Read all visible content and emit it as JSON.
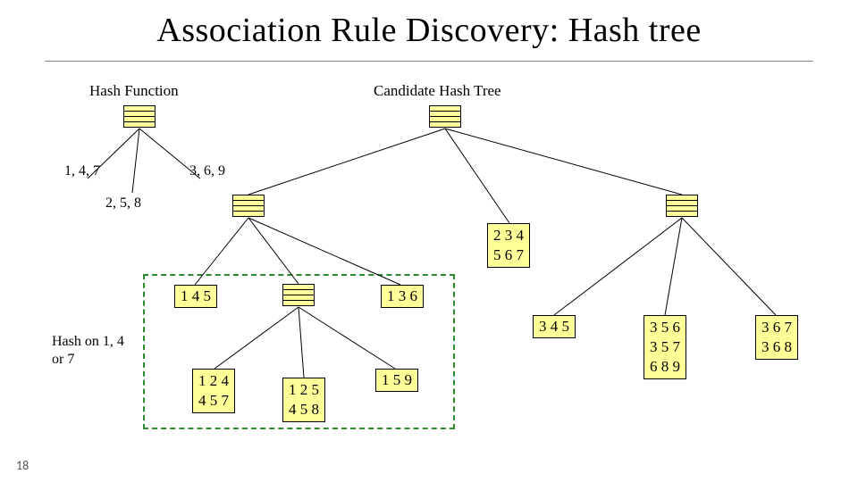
{
  "title": "Association Rule Discovery: Hash tree",
  "labels": {
    "hash_function": "Hash Function",
    "candidate_tree": "Candidate Hash Tree",
    "branch_left": "1, 4, 7",
    "branch_mid": "2, 5, 8",
    "branch_right": "3, 6, 9",
    "hash_on": "Hash on 1, 4\nor 7"
  },
  "leaves": {
    "L145": "1 4 5",
    "L234": "2 3 4",
    "L567": "5 6 7",
    "L136": "1 3 6",
    "L345": "3 4 5",
    "L356": "3 5 6",
    "L357": "3 5 7",
    "L689": "6 8 9",
    "L367": "3 6 7",
    "L368": "3 6 8",
    "L124": "1 2 4",
    "L457": "4 5 7",
    "L125": "1 2 5",
    "L458": "4 5 8",
    "L159": "1 5 9"
  },
  "page_number": "18",
  "chart_data": {
    "type": "tree",
    "description": "Candidate hash tree for 3-itemsets. Hash function on each internal node: left child if key mod in {1,4,7}, middle if {2,5,8}, right if {3,6,9}. Dashed box highlights subtree reached by hashing on first item in {1,4,7}.",
    "hash_function": {
      "left": [
        1,
        4,
        7
      ],
      "middle": [
        2,
        5,
        8
      ],
      "right": [
        3,
        6,
        9
      ]
    },
    "root_children": {
      "left": {
        "children": {
          "left": [
            "1 4 5"
          ],
          "middle": {
            "children": {
              "left": [
                "1 2 4",
                "4 5 7"
              ],
              "middle": [
                "1 2 5",
                "4 5 8"
              ],
              "right": [
                "1 5 9"
              ]
            }
          },
          "right": [
            "1 3 6"
          ]
        }
      },
      "middle": [
        "2 3 4",
        "5 6 7"
      ],
      "right": {
        "children": {
          "left": [
            "3 4 5"
          ],
          "middle": [
            "3 5 6",
            "3 5 7",
            "6 8 9"
          ],
          "right": [
            "3 6 7",
            "3 6 8"
          ]
        }
      }
    },
    "highlighted_subtree": "root.left (hash on first item ∈ {1,4,7})"
  }
}
